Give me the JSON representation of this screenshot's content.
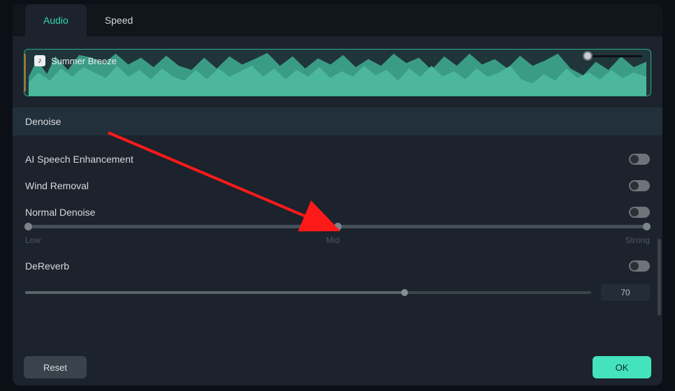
{
  "tabs": {
    "audio": "Audio",
    "speed": "Speed"
  },
  "clip": {
    "title": "Summer Breeze"
  },
  "section": {
    "denoise": "Denoise"
  },
  "options": {
    "ai_speech": "AI Speech Enhancement",
    "wind_removal": "Wind Removal",
    "normal_denoise": "Normal Denoise",
    "dereverb": "DeReverb"
  },
  "slider": {
    "low": "Low",
    "mid": "Mid",
    "strong": "Strong"
  },
  "dereverb": {
    "value": "70"
  },
  "buttons": {
    "reset": "Reset",
    "ok": "OK"
  },
  "colors": {
    "accent": "#34d6b4",
    "ok_btn": "#44e3bd"
  }
}
